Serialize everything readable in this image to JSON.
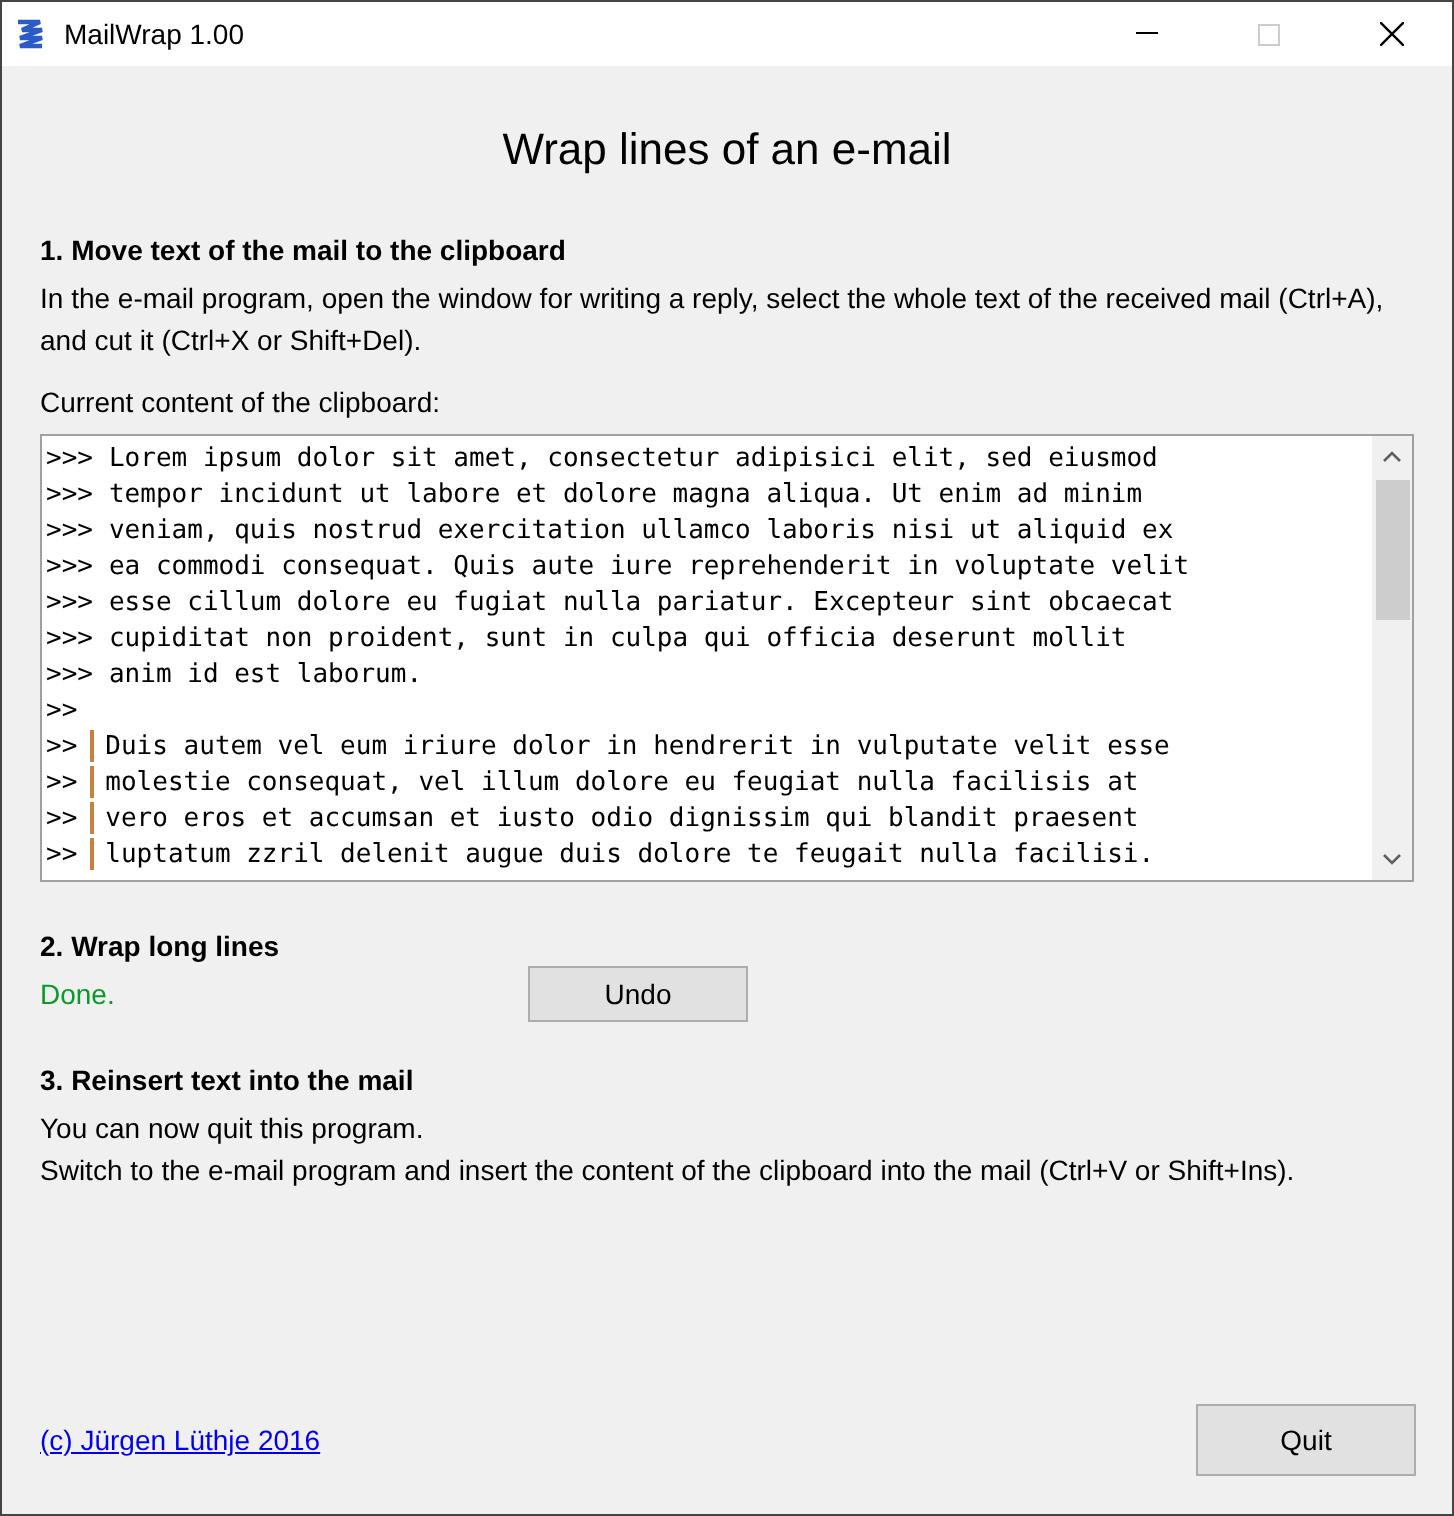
{
  "window": {
    "title": "MailWrap 1.00"
  },
  "heading": "Wrap lines of an e-mail",
  "step1": {
    "title": "1. Move text of the mail to the clipboard",
    "text": "In the e-mail program, open the window for writing a reply, select the whole text of the received mail (Ctrl+A), and cut it (Ctrl+X or Shift+Del).",
    "clipboard_label": "Current content of the clipboard:",
    "clipboard_lines": [
      {
        "prefix": ">>>",
        "quote_bar": false,
        "text": "Lorem ipsum dolor sit amet, consectetur adipisici elit, sed eiusmod"
      },
      {
        "prefix": ">>>",
        "quote_bar": false,
        "text": "tempor incidunt ut labore et dolore magna aliqua. Ut enim ad minim"
      },
      {
        "prefix": ">>>",
        "quote_bar": false,
        "text": "veniam, quis nostrud exercitation ullamco laboris nisi ut aliquid ex"
      },
      {
        "prefix": ">>>",
        "quote_bar": false,
        "text": "ea commodi consequat. Quis aute iure reprehenderit in voluptate velit"
      },
      {
        "prefix": ">>>",
        "quote_bar": false,
        "text": "esse cillum dolore eu fugiat nulla pariatur. Excepteur sint obcaecat"
      },
      {
        "prefix": ">>>",
        "quote_bar": false,
        "text": "cupiditat non proident, sunt in culpa qui officia deserunt mollit"
      },
      {
        "prefix": ">>>",
        "quote_bar": false,
        "text": "anim id est laborum."
      },
      {
        "prefix": ">>",
        "quote_bar": false
      },
      {
        "prefix": ">>",
        "quote_bar": true,
        "text": "Duis autem vel eum iriure dolor in hendrerit in vulputate velit esse"
      },
      {
        "prefix": ">>",
        "quote_bar": true,
        "text": "molestie consequat, vel illum dolore eu feugiat nulla facilisis at"
      },
      {
        "prefix": ">>",
        "quote_bar": true,
        "text": "vero eros et accumsan et iusto odio dignissim qui blandit praesent"
      },
      {
        "prefix": ">>",
        "quote_bar": true,
        "text": "luptatum zzril delenit augue duis dolore te feugait nulla facilisi."
      }
    ]
  },
  "step2": {
    "title": "2. Wrap long lines",
    "status": "Done.",
    "undo_button": "Undo"
  },
  "step3": {
    "title": "3. Reinsert text into the mail",
    "lines": [
      "You can now quit this program.",
      "Switch to the e-mail program and insert the content of the clipboard into the mail (Ctrl+V or Shift+Ins)."
    ]
  },
  "footer": {
    "link": "(c) Jürgen Lüthje 2016",
    "quit_button": "Quit"
  }
}
